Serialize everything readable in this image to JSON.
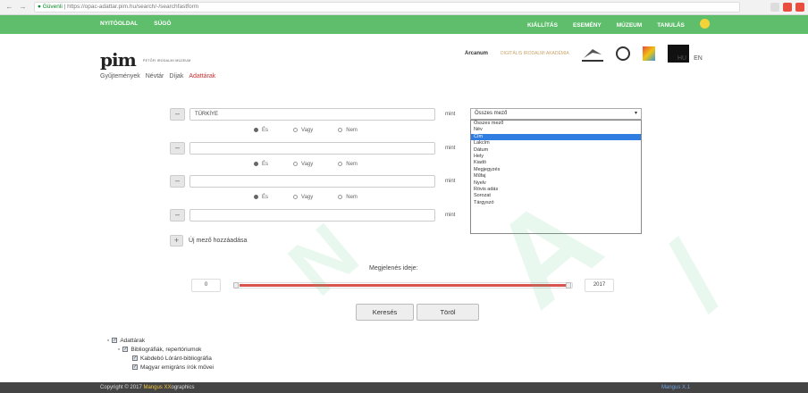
{
  "browser": {
    "back": "←",
    "forward": "→",
    "reload": "C",
    "secure_label": "Güvenli",
    "url": "https://opac-adattar.pim.hu/search/-/searchfastform"
  },
  "topbar": {
    "left": [
      "NYITÓOLDAL",
      "SÚGÓ"
    ],
    "right": [
      "KIÁLLÍTÁS",
      "ESEMÉNY",
      "MÚZEUM",
      "TANULÁS"
    ]
  },
  "brand": {
    "logo": "pim",
    "subtitle": "PETŐFI IRODALMI MÚZEUM"
  },
  "nav": {
    "links": [
      "Gyűjtemények",
      "Névtár",
      "Díjak",
      "Adattárak"
    ]
  },
  "partners": [
    "Arcanum",
    "DIGITÁLIS IRODALMI AKADÉMIA",
    "",
    ""
  ],
  "lang": [
    "HU",
    "EN"
  ],
  "search": {
    "rows": [
      {
        "value": "TÜRKİYE",
        "mint": "mint"
      },
      {
        "value": "",
        "mint": "mint"
      },
      {
        "value": "",
        "mint": "mint"
      },
      {
        "value": "",
        "mint": "mint"
      }
    ],
    "bool_options": [
      "És",
      "Vagy",
      "Nem"
    ],
    "selected_bool": "És",
    "field_selected": "Összes mező",
    "field_options": [
      "Összes mező",
      "Név",
      "Cím",
      "Lakcím",
      "Dátum",
      "Hely",
      "Kiadó",
      "Megjegyzés",
      "Műfaj",
      "Nyelv",
      "Rövis adás",
      "Sorozat",
      "Tárgyszó"
    ],
    "highlighted_option": "Cím",
    "add_field_label": "Új mező hozzáadása"
  },
  "period": {
    "title": "Megjelenés ideje:",
    "from": "0",
    "to": "2017",
    "range_fraction": 1.0
  },
  "buttons": {
    "search": "Keresés",
    "clear": "Töröl"
  },
  "tree": [
    {
      "label": "Adattárak",
      "level": 0
    },
    {
      "label": "Bibliográfiák, repertóriumok",
      "level": 1
    },
    {
      "label": "Kabdebó Lóránt-bibliográfia",
      "level": 2
    },
    {
      "label": "Magyar emigráns írók művei",
      "level": 2
    }
  ],
  "footer": {
    "copyright": "Copyright © 2017",
    "brand": "Mangus XX",
    "suffix": "ographics",
    "right": "Mangus X.1"
  }
}
